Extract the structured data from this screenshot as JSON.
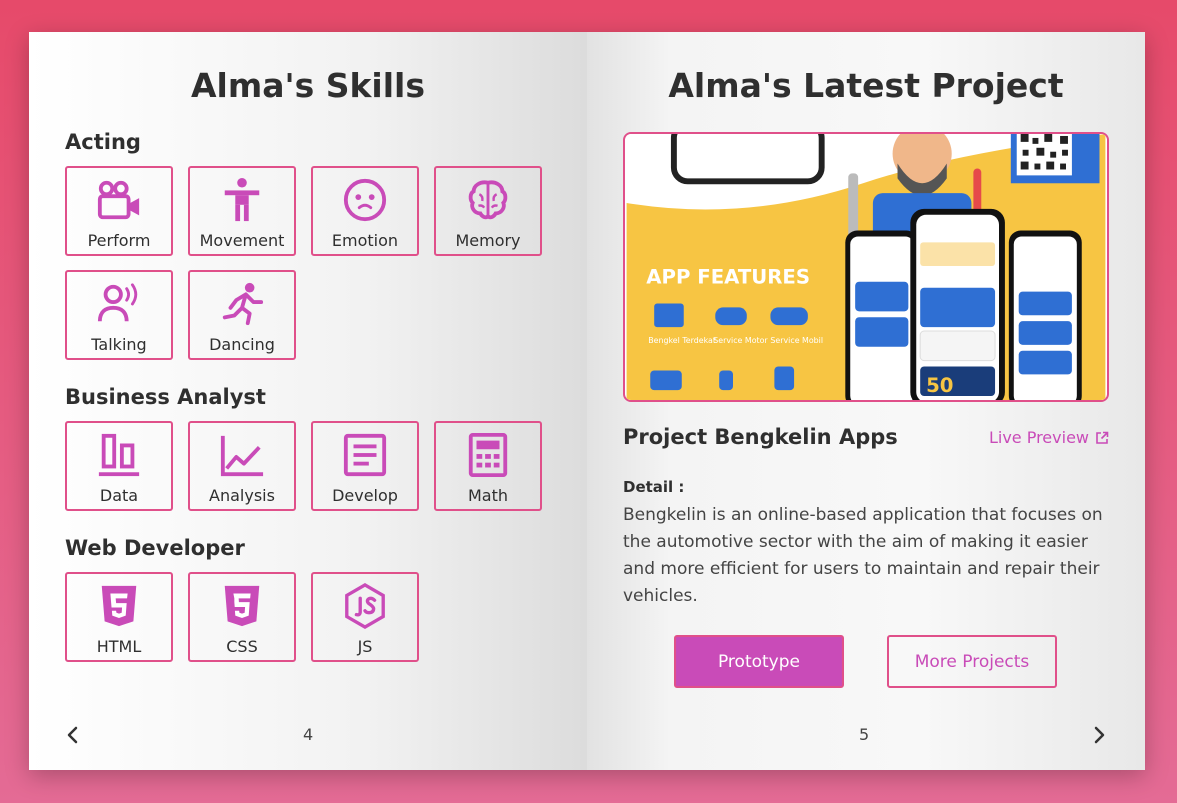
{
  "left_page": {
    "title": "Alma's Skills",
    "sections": [
      {
        "title": "Acting",
        "skills": [
          {
            "label": "Perform",
            "icon": "video-camera-icon"
          },
          {
            "label": "Movement",
            "icon": "person-standing-icon"
          },
          {
            "label": "Emotion",
            "icon": "face-icon"
          },
          {
            "label": "Memory",
            "icon": "brain-icon"
          },
          {
            "label": "Talking",
            "icon": "person-voice-icon"
          },
          {
            "label": "Dancing",
            "icon": "running-person-icon"
          }
        ]
      },
      {
        "title": "Business Analyst",
        "skills": [
          {
            "label": "Data",
            "icon": "bar-chart-icon"
          },
          {
            "label": "Analysis",
            "icon": "line-chart-icon"
          },
          {
            "label": "Develop",
            "icon": "document-icon"
          },
          {
            "label": "Math",
            "icon": "calculator-icon"
          }
        ]
      },
      {
        "title": "Web Developer",
        "skills": [
          {
            "label": "HTML",
            "icon": "html5-icon"
          },
          {
            "label": "CSS",
            "icon": "css3-icon"
          },
          {
            "label": "JS",
            "icon": "nodejs-icon"
          }
        ]
      }
    ],
    "page_number": "4"
  },
  "right_page": {
    "title": "Alma's Latest Project",
    "project_name": "Project Bengkelin Apps",
    "live_preview": "Live Preview",
    "detail_label": "Detail :",
    "detail_text": "Bengkelin is an online-based application that focuses on the automotive sector with the aim of making it easier and more efficient for users to maintain and repair their vehicles.",
    "image": {
      "headline": "APP FEATURES",
      "features": [
        "Bengkel Terdekat",
        "Service Motor",
        "Service Mobil"
      ],
      "promo_number": "50"
    },
    "buttons": {
      "primary": "Prototype",
      "secondary": "More Projects"
    },
    "page_number": "5"
  },
  "colors": {
    "accent": "#c94bb8",
    "border": "#e0508a",
    "image_yellow": "#f7c543",
    "image_blue": "#2f6fd3"
  }
}
